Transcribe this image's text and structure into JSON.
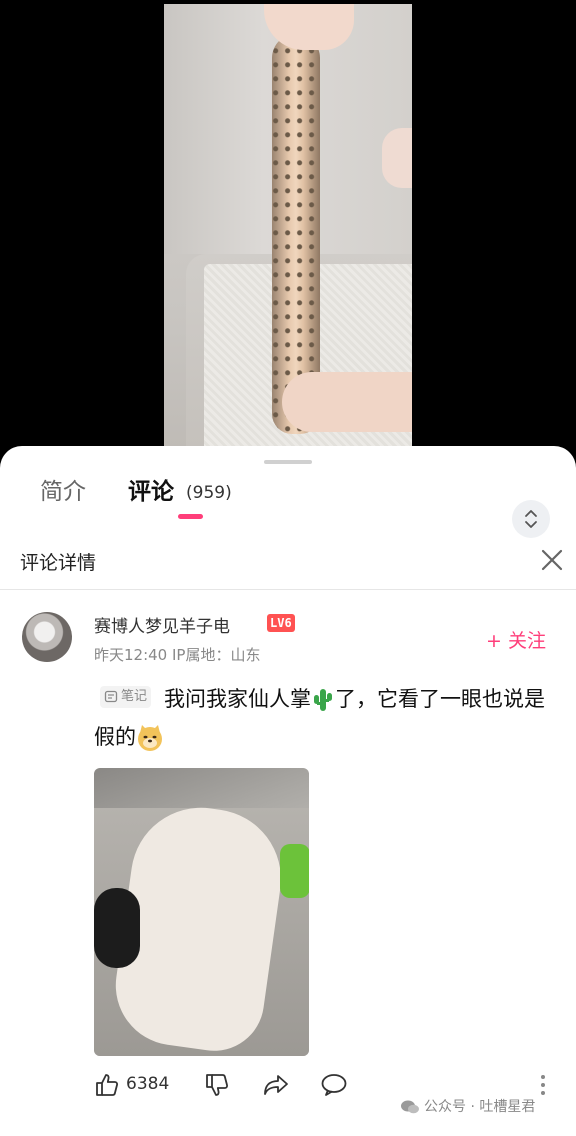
{
  "tabs": {
    "intro_label": "简介",
    "comments_label": "评论",
    "comments_count": "(959)"
  },
  "detail": {
    "title": "评论详情"
  },
  "comment": {
    "username": "赛博人梦见羊子电",
    "level_badge": "LV6",
    "meta": "昨天12:40  IP属地：山东",
    "follow_label": "+ 关注",
    "note_tag": "笔记",
    "text_part1": "我问我家仙人掌",
    "text_part2": "了，它看了一眼也说是假的",
    "emoji_1": "cactus-emoji",
    "emoji_2": "doge-emoji",
    "like_count": "6384"
  },
  "watermark": {
    "text": "公众号 · 吐槽星君"
  },
  "colors": {
    "accent": "#ff3e7a",
    "badge": "#ff5252"
  }
}
